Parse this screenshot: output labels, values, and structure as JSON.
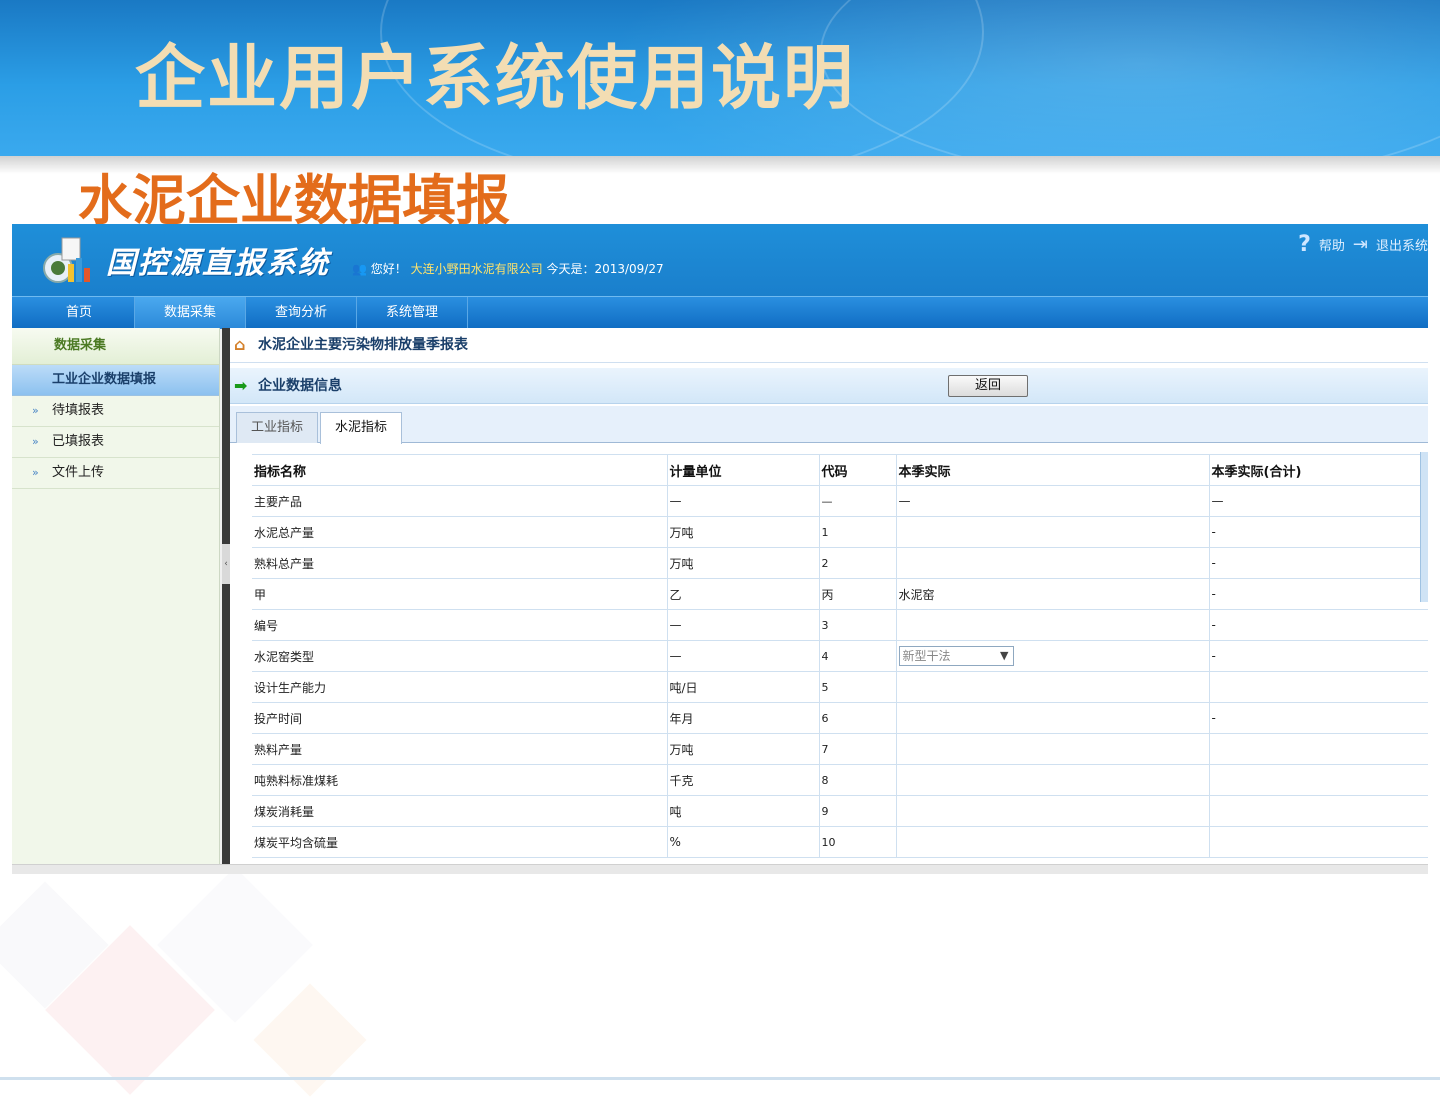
{
  "slide": {
    "title": "企业用户系统使用说明",
    "subtitle": "水泥企业数据填报"
  },
  "app": {
    "system_name": "国控源直报系统",
    "greeting_prefix": "您好！",
    "company": "大连小野田水泥有限公司",
    "date_label": "今天是：2013/09/27",
    "help_label": "帮助",
    "logout_label": "退出系统",
    "nav": [
      "首页",
      "数据采集",
      "查询分析",
      "系统管理"
    ],
    "sidebar": {
      "header": "数据采集",
      "active": "工业企业数据填报",
      "items": [
        "待填报表",
        "已填报表",
        "文件上传"
      ]
    },
    "breadcrumb": "水泥企业主要污染物排放量季报表",
    "section_title": "企业数据信息",
    "back_button": "返回",
    "tabs": [
      "工业指标",
      "水泥指标"
    ],
    "table": {
      "headers": [
        "指标名称",
        "计量单位",
        "代码",
        "本季实际",
        "本季实际(合计)"
      ],
      "rows": [
        [
          "主要产品",
          "—",
          "—",
          "—",
          "—"
        ],
        [
          "水泥总产量",
          "万吨",
          "1",
          "",
          "-"
        ],
        [
          "熟料总产量",
          "万吨",
          "2",
          "",
          "-"
        ],
        [
          "甲",
          "乙",
          "丙",
          "水泥窑",
          "-"
        ],
        [
          "编号",
          "—",
          "3",
          "",
          "-"
        ],
        [
          "水泥窑类型",
          "—",
          "4",
          "",
          "-"
        ],
        [
          "设计生产能力",
          "吨/日",
          "5",
          "",
          ""
        ],
        [
          "投产时间",
          "年月",
          "6",
          "",
          "-"
        ],
        [
          "熟料产量",
          "万吨",
          "7",
          "",
          ""
        ],
        [
          "吨熟料标准煤耗",
          "千克",
          "8",
          "",
          ""
        ],
        [
          "煤炭消耗量",
          "吨",
          "9",
          "",
          ""
        ],
        [
          "煤炭平均含硫量",
          "%",
          "10",
          "",
          ""
        ]
      ],
      "kiln_type_select": "新型干法"
    }
  }
}
